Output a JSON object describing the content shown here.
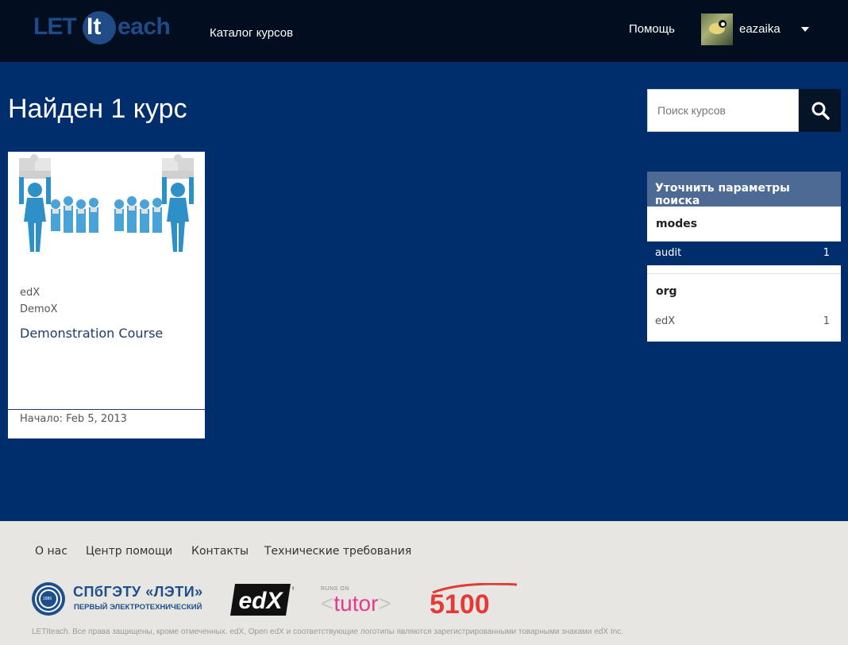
{
  "header": {
    "logo": {
      "part1": "LET",
      "part2": "It",
      "part3": "each"
    },
    "nav_catalog": "Каталог курсов",
    "nav_help": "Помощь",
    "username": "eazaika"
  },
  "main": {
    "results_title": "Найден 1 курс",
    "search_placeholder": "Поиск курсов"
  },
  "course": {
    "org": "edX",
    "code": "DemoX",
    "name": "Demonstration Course",
    "start": "Начало: Feb 5, 2013"
  },
  "filters": {
    "title": "Уточнить параметры поиска",
    "facets": [
      {
        "name": "modes",
        "options": [
          {
            "label": "audit",
            "count": "1",
            "active": true
          }
        ]
      },
      {
        "name": "org",
        "options": [
          {
            "label": "edX",
            "count": "1",
            "active": false
          }
        ]
      }
    ]
  },
  "footer": {
    "links": [
      "О нас",
      "Центр помощи",
      "Контакты",
      "Технические требования"
    ],
    "leti_title": "СПбГЭТУ «ЛЭТИ»",
    "leti_subtitle": "ПЕРВЫЙ ЭЛЕКТРОТЕХНИЧЕСКИЙ",
    "leti_year": "1886",
    "edx_logo": "edX",
    "tutor_small": "RUNS ON",
    "tutor_main": "<tutor>",
    "logo_5100": "5100",
    "copyright": "LETIteach. Все права защищены, кроме отмеченных. edX, Open edX и соответствующие логотипы являются зарегистрированными товарными знаками edX Inc."
  },
  "colors": {
    "header_bg": "#020d20",
    "main_bg": "#002d6b",
    "filter_header_bg": "#4c6a94",
    "footer_bg": "#e8e6e2",
    "accent_pink": "#e43b8e",
    "brand_blue": "#1c4f8c"
  }
}
